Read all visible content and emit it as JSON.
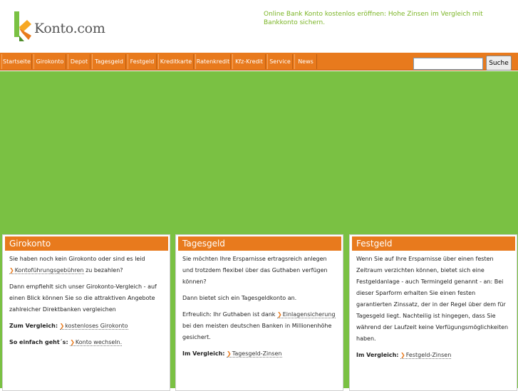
{
  "header": {
    "logo_text": "Konto.com",
    "tagline": "Online Bank Konto kostenlos eröffnen: Hohe Zinsen im Vergleich mit Bankkonto sichern."
  },
  "nav": {
    "items": [
      "Startseite",
      "Girokonto",
      "Depot",
      "Tagesgeld",
      "Festgeld",
      "Kreditkarte",
      "Ratenkredit",
      "Kfz-Kredit",
      "Service",
      "News"
    ]
  },
  "search": {
    "button_label": "Suche",
    "value": ""
  },
  "cards": [
    {
      "title": "Girokonto",
      "p1_text": "Sie haben noch kein Girokonto oder sind es leid",
      "p1_link": "Kontoführungsgebühren",
      "p1_after": "zu bezahlen?",
      "p2_text": "Dann empfiehlt sich unser Girokonto-Vergleich - auf einen Blick können Sie so die attraktiven Angebote zahlreicher Direktbanken vergleichen",
      "row1_label": "Zum Vergleich:",
      "row1_link": "kostenloses Girokonto",
      "row2_label": "So einfach geht´s:",
      "row2_link": "Konto wechseln."
    },
    {
      "title": "Tagesgeld",
      "p1_text": "Sie möchten Ihre Ersparnisse ertragsreich anlegen und trotzdem flexibel über das Guthaben verfügen können?",
      "p2_text": "Dann bietet sich ein Tagesgeldkonto an.",
      "p3_before": "Erfreulich: Ihr Guthaben ist dank",
      "p3_link": "Einlagensicherung",
      "p3_after": "bei den meisten deutschen Banken in Millionenhöhe gesichert.",
      "row1_label": "Im Vergleich:",
      "row1_link": "Tagesgeld-Zinsen"
    },
    {
      "title": "Festgeld",
      "p1_text": "Wenn Sie auf Ihre Ersparnisse über einen festen Zeitraum verzichten können, bietet sich eine Festgeldanlage - auch Termingeld genannt - an: Bei dieser Sparform erhalten Sie einen festen garantierten Zinssatz, der in der Regel über dem für Tagesgeld liegt. Nachteilig ist hingegen, dass Sie während der Laufzeit keine Verfügungsmöglichkeiten haben.",
      "row1_label": "Im Vergleich:",
      "row1_link": "Festgeld-Zinsen"
    }
  ],
  "colors": {
    "accent_orange": "#e87a1d",
    "brand_green": "#7ac143",
    "tagline_green": "#7ab424"
  }
}
